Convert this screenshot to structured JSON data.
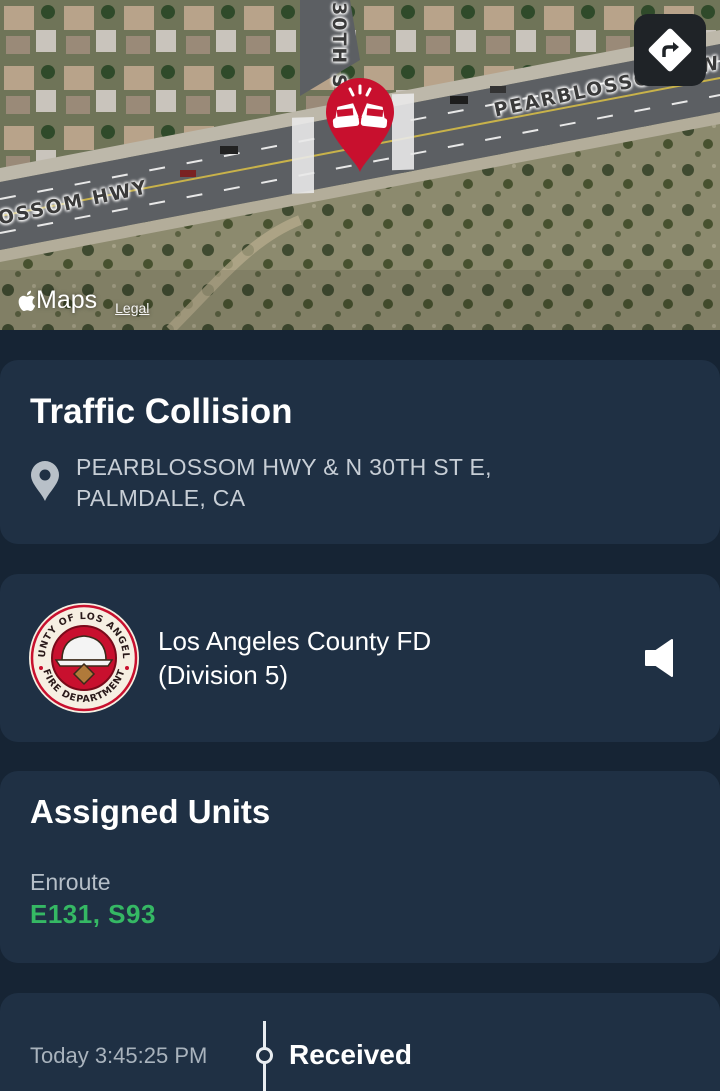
{
  "map": {
    "road_labels": {
      "pearblossom_left": "OSSOM HWY",
      "pearblossom_right": "PEARBLOSSOM HW",
      "cross_street": "30TH S"
    },
    "brand": "Maps",
    "legal": "Legal",
    "directions_icon": "directions-icon",
    "incident_pin_icon": "car-collision-icon",
    "pin_color": "#c8102e"
  },
  "incident": {
    "title": "Traffic Collision",
    "address_line1": "PEARBLOSSOM HWY & N 30TH ST E,",
    "address_line2": "PALMDALE, CA",
    "location_icon": "location-pin-icon"
  },
  "agency": {
    "name_line1": "Los Angeles County FD",
    "name_line2": "(Division 5)",
    "seal_top_text": "COUNTY OF LOS ANGELES",
    "seal_bottom_text": "FIRE DEPARTMENT",
    "audio_icon": "speaker-icon"
  },
  "units": {
    "title": "Assigned Units",
    "status": "Enroute",
    "list": "E131, S93",
    "status_color": "#35b864"
  },
  "timeline": {
    "time": "Today 3:45:25 PM",
    "event": "Received"
  },
  "colors": {
    "background": "#162434",
    "card": "#1f3044",
    "accent_green": "#35b864"
  }
}
